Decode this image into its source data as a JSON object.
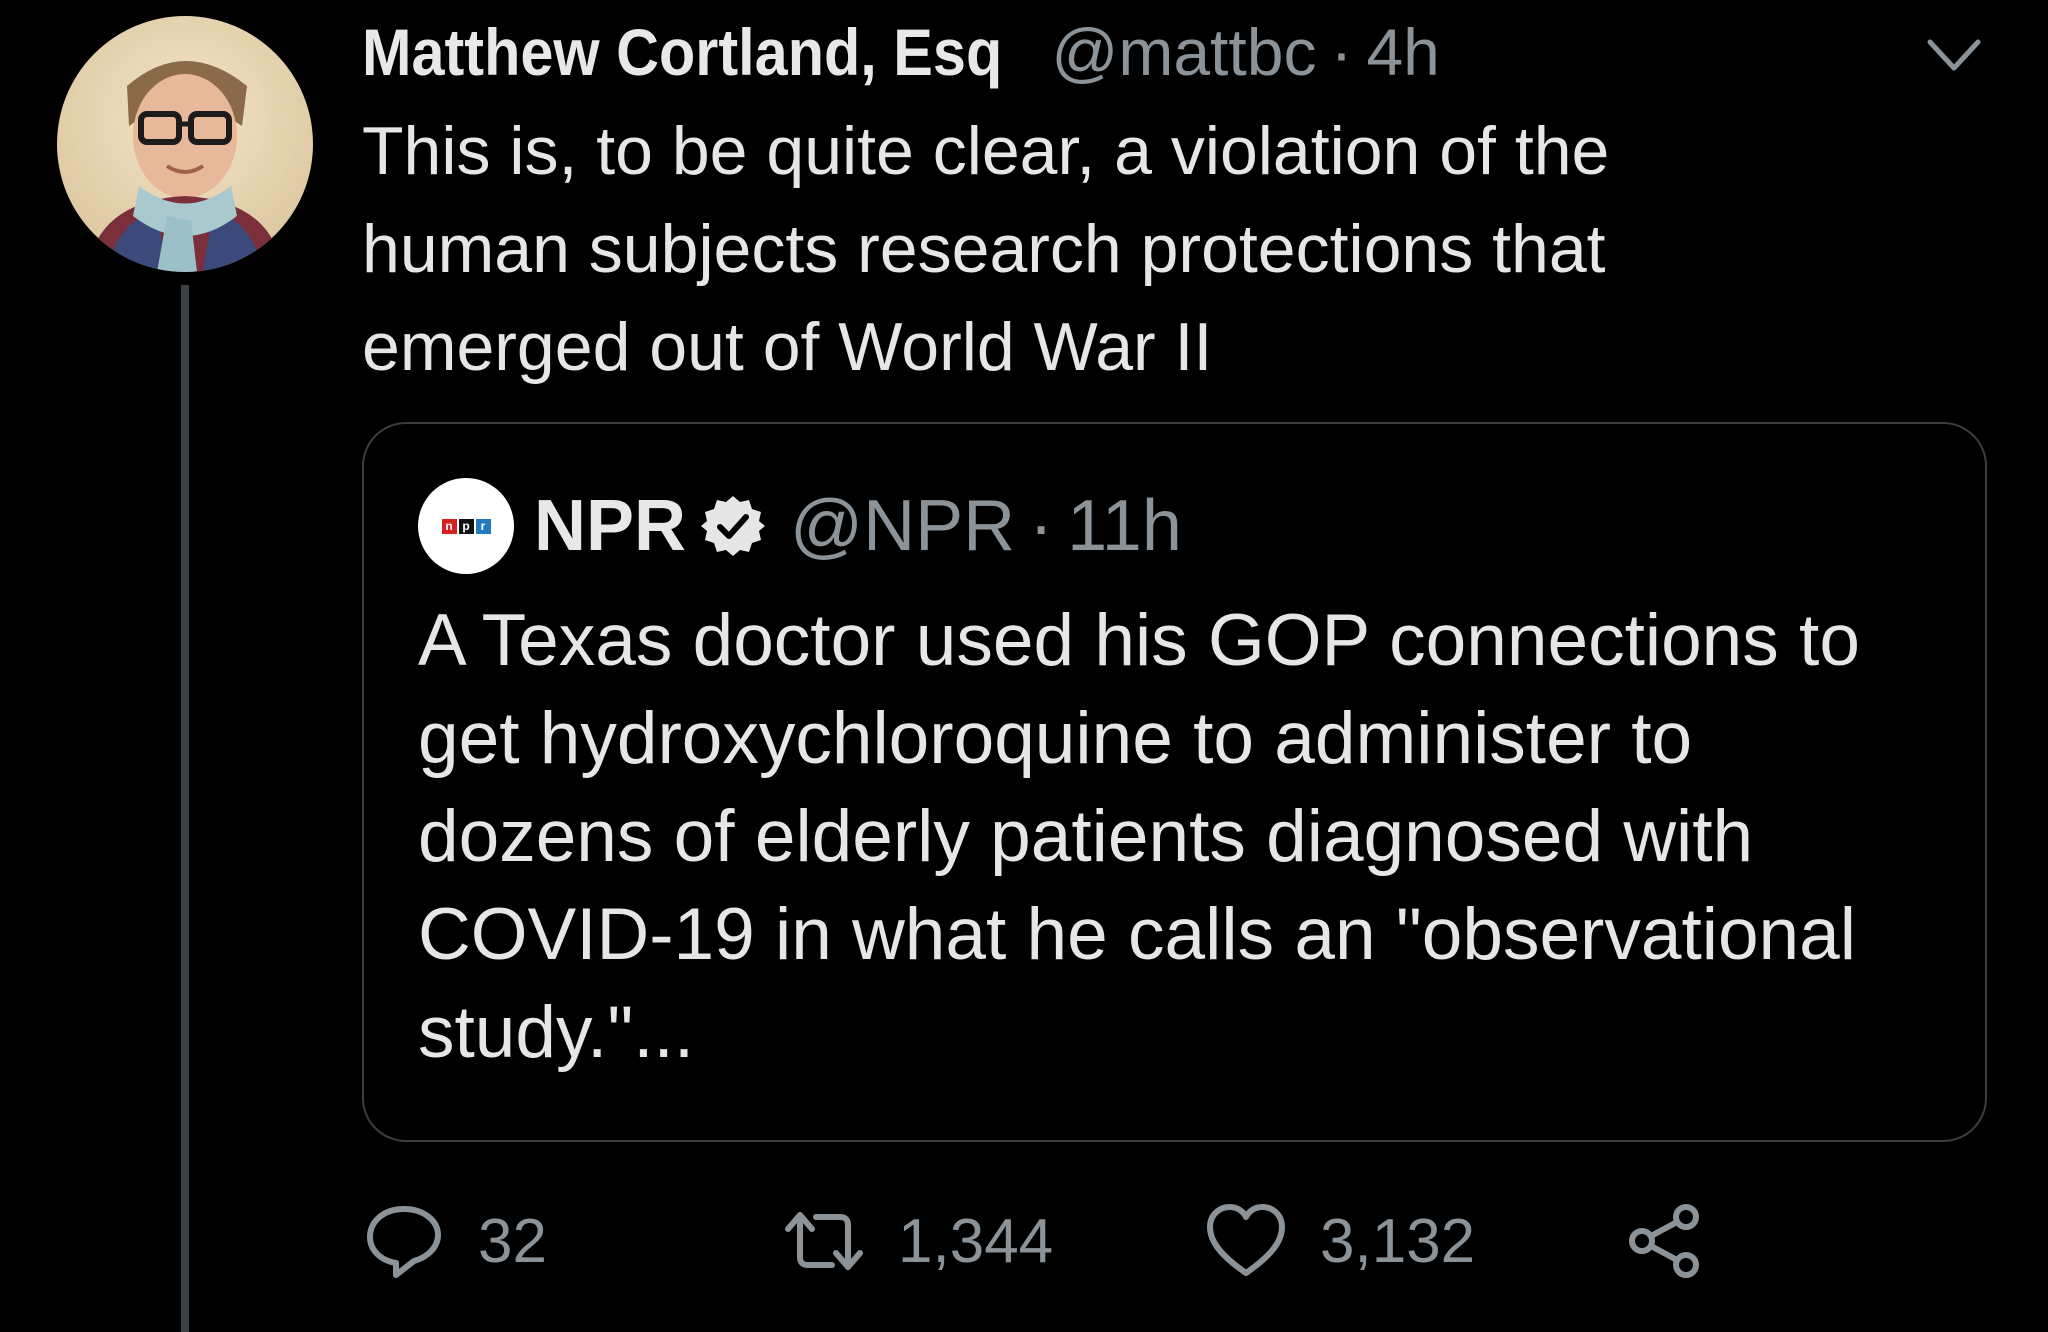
{
  "tweet": {
    "display_name": "Matthew Cortland, Esq",
    "handle": "@mattbc",
    "separator": "·",
    "time": "4h",
    "text_lines": [
      "This is, to be quite clear, a violation of the",
      "human subjects research protections that",
      "emerged out of World War II"
    ]
  },
  "quoted": {
    "logo_letters": [
      "n",
      "p",
      "r"
    ],
    "display_name": "NPR",
    "handle": "@NPR",
    "separator": "·",
    "time": "11h",
    "text_lines": [
      "A Texas doctor used his GOP connections to",
      "get hydroxychloroquine to administer to",
      "dozens of elderly patients diagnosed with",
      "COVID-19 in what he calls an \"observational",
      "study.\"..."
    ]
  },
  "actions": {
    "replies": "32",
    "retweets": "1,344",
    "likes": "3,132"
  },
  "icons": {
    "reply": "reply-icon",
    "retweet": "retweet-icon",
    "like": "heart-icon",
    "share": "share-icon",
    "menu": "chevron-down-icon",
    "verified": "verified-badge-icon"
  },
  "colors": {
    "background": "#000000",
    "text": "#e6e6e6",
    "secondary": "#8b9298",
    "border": "#3a3d42",
    "npr_red": "#d62021",
    "npr_black": "#111111",
    "npr_blue": "#237bbd"
  }
}
